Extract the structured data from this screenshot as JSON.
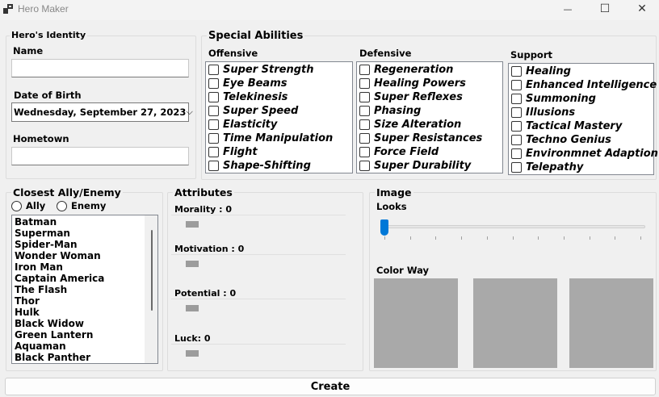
{
  "window": {
    "title": "Hero Maker",
    "minimize": "—",
    "maximize": "☐",
    "close": "✕"
  },
  "identity": {
    "title": "Hero's Identity",
    "name_label": "Name",
    "name_value": "",
    "dob_label": "Date of Birth",
    "dob_value": "Wednesday, September 27, 2023",
    "dob_arrow": "⌵",
    "hometown_label": "Hometown",
    "hometown_value": ""
  },
  "abilities": {
    "title": "Special Abilities",
    "offensive": {
      "title": "Offensive",
      "items": [
        "Super Strength",
        "Eye Beams",
        "Telekinesis",
        "Super Speed",
        "Elasticity",
        "Time Manipulation",
        "Flight",
        "Shape-Shifting"
      ]
    },
    "defensive": {
      "title": "Defensive",
      "items": [
        "Regeneration",
        "Healing Powers",
        "Super Reflexes",
        "Phasing",
        "Size Alteration",
        "Super Resistances",
        "Force Field",
        "Super Durability"
      ]
    },
    "support": {
      "title": "Support",
      "items": [
        "Healing",
        "Enhanced Intelligence",
        "Summoning",
        "Illusions",
        "Tactical Mastery",
        "Techno Genius",
        "Environmnet Adaption",
        "Telepathy"
      ]
    }
  },
  "ally": {
    "title": "Closest Ally/Enemy",
    "ally_label": "Ally",
    "enemy_label": "Enemy",
    "items": [
      "Batman",
      "Superman",
      "Spider-Man",
      "Wonder Woman",
      "Iron Man",
      "Captain America",
      "The Flash",
      "Thor",
      "Hulk",
      "Black Widow",
      "Green Lantern",
      "Aquaman",
      "Black Panther"
    ]
  },
  "attributes": {
    "title": "Attributes",
    "items": [
      {
        "label": "Morality : 0",
        "value": 0
      },
      {
        "label": "Motivation : 0",
        "value": 0
      },
      {
        "label": "Potential : 0",
        "value": 0
      },
      {
        "label": "Luck: 0",
        "value": 0
      }
    ]
  },
  "image": {
    "title": "Image",
    "looks_label": "Looks",
    "looks_value": 0,
    "colorway_label": "Color Way",
    "swatch_color": "#a9a9a9"
  },
  "create_label": "Create",
  "colors": {
    "accent": "#0078d7",
    "swatch": "#a9a9a9"
  }
}
